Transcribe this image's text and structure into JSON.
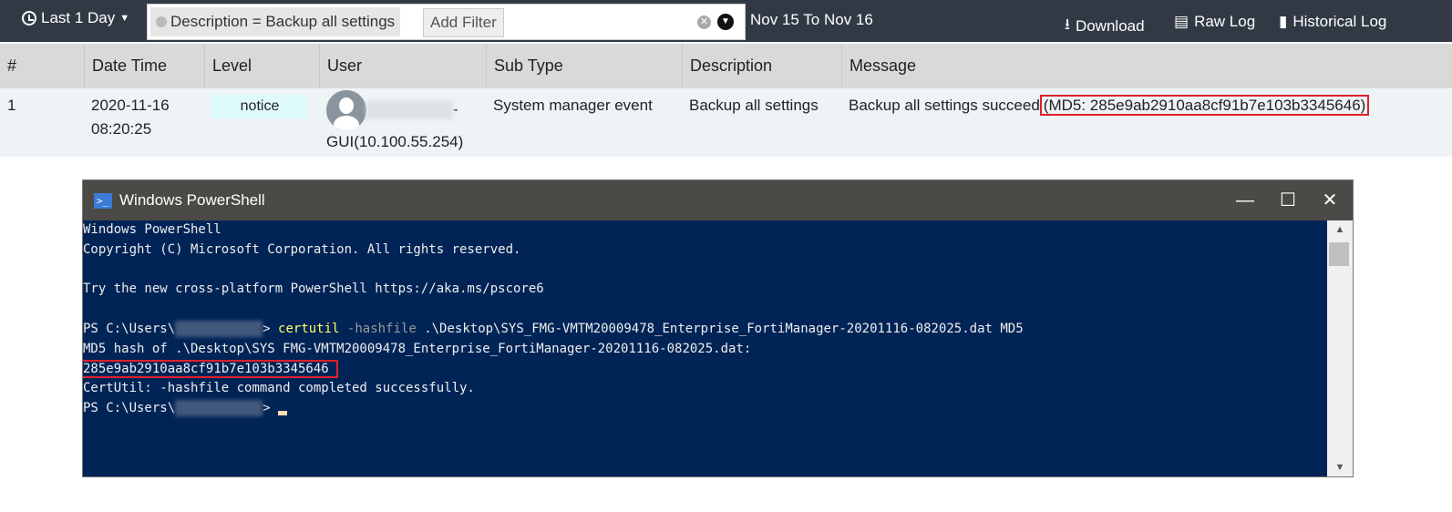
{
  "toolbar": {
    "range": "Last 1 Day",
    "filter_chip": "Description = Backup all settings",
    "add_filter": "Add Filter",
    "date_range": "Nov 15 To Nov 16",
    "download": "Download",
    "raw_log": "Raw Log",
    "historical_log": "Historical Log"
  },
  "table": {
    "headers": [
      "#",
      "Date Time",
      "Level",
      "User",
      "Sub Type",
      "Description",
      "Message"
    ],
    "rows": [
      {
        "num": "1",
        "date": "2020-11-16",
        "time": "08:20:25",
        "level": "notice",
        "user_suffix": "-",
        "user_line2": "GUI(10.100.55.254)",
        "sub_type": "System manager event",
        "description": "Backup all settings",
        "message": "Backup all settings succeed",
        "message_md5": "(MD5: 285e9ab2910aa8cf91b7e103b3345646)"
      }
    ]
  },
  "powershell": {
    "title": "Windows PowerShell",
    "min": "—",
    "max": "☐",
    "close": "✕",
    "lines": {
      "l1": "Windows PowerShell",
      "l2": "Copyright (C) Microsoft Corporation. All rights reserved.",
      "l3": "Try the new cross-platform PowerShell https://aka.ms/pscore6",
      "prompt": "PS C:\\Users\\",
      "prompt_end": ">",
      "cmd": "certutil",
      "flag": "-hashfile",
      "args": ".\\Desktop\\SYS_FMG-VMTM20009478_Enterprise_FortiManager-20201116-082025.dat MD5",
      "l5": "MD5 hash of .\\Desktop\\SYS FMG-VMTM20009478_Enterprise_FortiManager-20201116-082025.dat:",
      "hash": "285e9ab2910aa8cf91b7e103b3345646",
      "l7": "CertUtil: -hashfile command completed successfully."
    }
  },
  "colors": {
    "topbar": "#313a44",
    "console_bg": "#012456",
    "highlight": "#e0202a"
  }
}
